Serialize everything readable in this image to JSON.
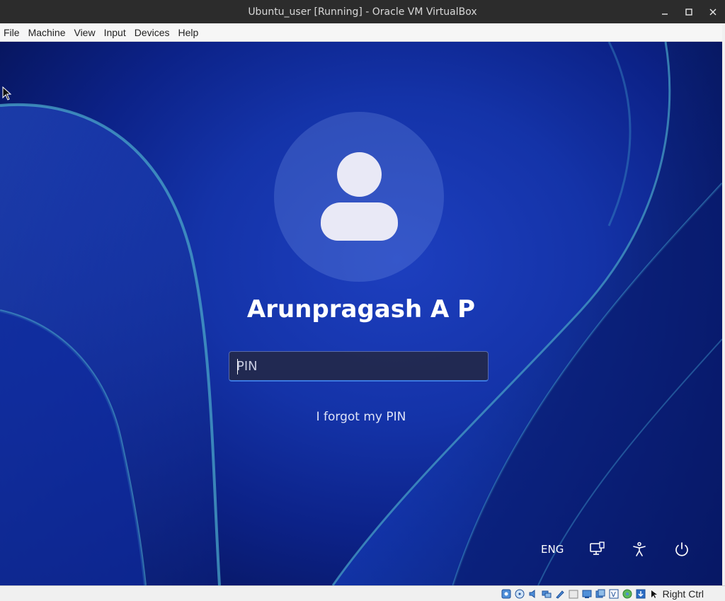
{
  "window": {
    "title": "Ubuntu_user [Running] - Oracle VM VirtualBox",
    "controls": [
      "minimize-icon",
      "maximize-icon",
      "close-icon"
    ]
  },
  "menubar": {
    "items": [
      "File",
      "Machine",
      "View",
      "Input",
      "Devices",
      "Help"
    ]
  },
  "lockscreen": {
    "user_name": "Arunpragash A P",
    "pin_placeholder": "PIN",
    "pin_value": "",
    "forgot_link": "I forgot my PIN",
    "language": "ENG",
    "icons": [
      "network-icon",
      "accessibility-icon",
      "power-icon"
    ],
    "wallpaper_colors": {
      "deep": "#050f44",
      "mid": "#1433a8",
      "ribbon": "#4aa5c8"
    }
  },
  "statusbar": {
    "host_key": "Right Ctrl",
    "icons": [
      "hard-disk-icon",
      "optical-drive-icon",
      "audio-icon",
      "network-adapter-icon",
      "usb-icon",
      "shared-folders-icon",
      "display-icon",
      "recording-icon",
      "vt-x-icon",
      "guest-additions-icon",
      "mouse-integration-icon",
      "keyboard-capture-icon"
    ]
  }
}
